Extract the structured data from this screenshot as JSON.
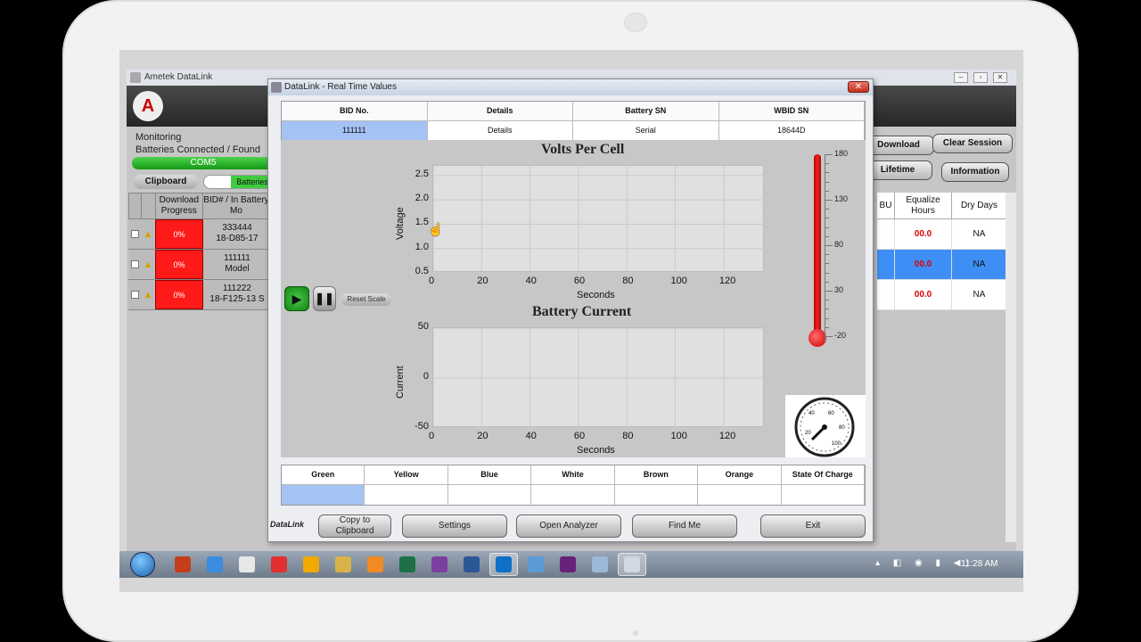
{
  "main_window": {
    "title": "Ametek DataLink",
    "monitoring_label": "Monitoring",
    "connected_label": "Batteries Connected / Found",
    "port": "COM5",
    "clipboard_label": "Clipboard",
    "toggle_label": "Batteries",
    "left_columns": [
      "Download Progress",
      "BID# / In Battery Mo"
    ],
    "left_rows": [
      {
        "progress": "0%",
        "bid": "333444",
        "model": "18-D85-17"
      },
      {
        "progress": "0%",
        "bid": "111111",
        "model": "Model"
      },
      {
        "progress": "0%",
        "bid": "111222",
        "model": "18-F125-13 S"
      }
    ],
    "buttons": {
      "download": "Download",
      "clear_session": "Clear Session",
      "lifetime": "Lifetime",
      "information": "Information"
    },
    "right_columns": [
      "BU",
      "Equalize Hours",
      "Dry Days"
    ],
    "right_rows": [
      {
        "equalize": "00.0",
        "dry": "NA",
        "selected": false
      },
      {
        "equalize": "00.0",
        "dry": "NA",
        "selected": true
      },
      {
        "equalize": "00.0",
        "dry": "NA",
        "selected": false
      }
    ]
  },
  "dialog": {
    "title": "DataLink - Real Time Values",
    "close": "✕",
    "info_headers": [
      "BID No.",
      "Details",
      "Battery SN",
      "WBID SN"
    ],
    "info_values": [
      "111111",
      "Details",
      "Serial",
      "18644D"
    ],
    "controls": {
      "play": "▶",
      "pause": "❚❚",
      "reset": "Reset Scale"
    },
    "thermometer_scale": [
      "180",
      "130",
      "80",
      "30",
      "-20"
    ],
    "gauge_labels": [
      "20",
      "40",
      "60",
      "80",
      "100"
    ],
    "bottom_headers": [
      "Green",
      "Yellow",
      "Blue",
      "White",
      "Brown",
      "Orange",
      "State Of Charge"
    ],
    "buttons": {
      "copy": "Copy to Clipboard",
      "settings": "Settings",
      "analyzer": "Open Analyzer",
      "find": "Find Me",
      "exit": "Exit"
    },
    "logo": "DataLink"
  },
  "chart_data": [
    {
      "type": "line",
      "title": "Volts Per Cell",
      "xlabel": "Seconds",
      "ylabel": "Voltage",
      "x_ticks": [
        0,
        20,
        40,
        60,
        80,
        100,
        120
      ],
      "y_ticks": [
        "0.5",
        "1.0",
        "1.5",
        "2.0",
        "2.5"
      ],
      "xlim": [
        0,
        137
      ],
      "ylim": [
        0.5,
        2.7
      ],
      "series": [],
      "grid": true
    },
    {
      "type": "line",
      "title": "Battery Current",
      "xlabel": "Seconds",
      "ylabel": "Current",
      "x_ticks": [
        0,
        20,
        40,
        60,
        80,
        100,
        120
      ],
      "y_ticks": [
        "-50",
        "0",
        "50"
      ],
      "xlim": [
        0,
        137
      ],
      "ylim": [
        -50,
        50
      ],
      "series": [],
      "grid": true
    }
  ],
  "taskbar": {
    "clock": "11:28 AM",
    "icons": [
      "ppt-icon",
      "ie-icon",
      "chrome-icon",
      "opera-icon",
      "media-icon",
      "explorer-icon",
      "paint-icon",
      "excel-icon",
      "onenote-icon",
      "word-icon",
      "outlook-icon",
      "app-icon",
      "vs-icon",
      "notepad-icon",
      "datalink-icon"
    ]
  },
  "colors": {
    "accent_green": "#2fbf2f",
    "alert_red": "#ff1a1a",
    "selection_blue": "#3d8ff5",
    "thermo_red": "#d00000"
  }
}
